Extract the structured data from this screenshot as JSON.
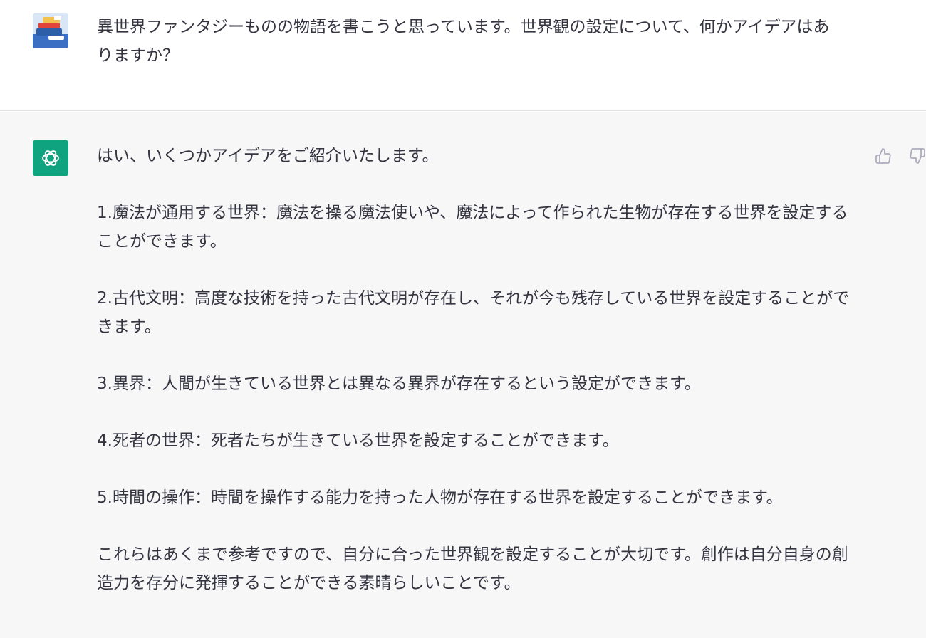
{
  "user_turn": {
    "avatar_icon": "user-avatar-image",
    "message": "異世界ファンタジーものの物語を書こうと思っています。世界観の設定について、何かアイデアはありますか？"
  },
  "assistant_turn": {
    "avatar_icon": "openai-logo-icon",
    "avatar_color": "#10a37f",
    "paragraphs": [
      "はい、いくつかアイデアをご紹介いたします。",
      "1.魔法が通用する世界：魔法を操る魔法使いや、魔法によって作られた生物が存在する世界を設定することができます。",
      "2.古代文明：高度な技術を持った古代文明が存在し、それが今も残存している世界を設定することができます。",
      "3.異界：人間が生きている世界とは異なる異界が存在するという設定ができます。",
      "4.死者の世界：死者たちが生きている世界を設定することができます。",
      "5.時間の操作：時間を操作する能力を持った人物が存在する世界を設定することができます。",
      "これらはあくまで参考ですので、自分に合った世界観を設定することが大切です。創作は自分自身の創造力を存分に発揮することができる素晴らしいことです。"
    ],
    "feedback_icons": [
      "thumbs-up-icon",
      "thumbs-down-icon"
    ]
  },
  "colors": {
    "user_bg": "#ffffff",
    "assistant_bg": "#f7f7f8",
    "text": "#343541",
    "icon_gray": "#acacbe"
  }
}
